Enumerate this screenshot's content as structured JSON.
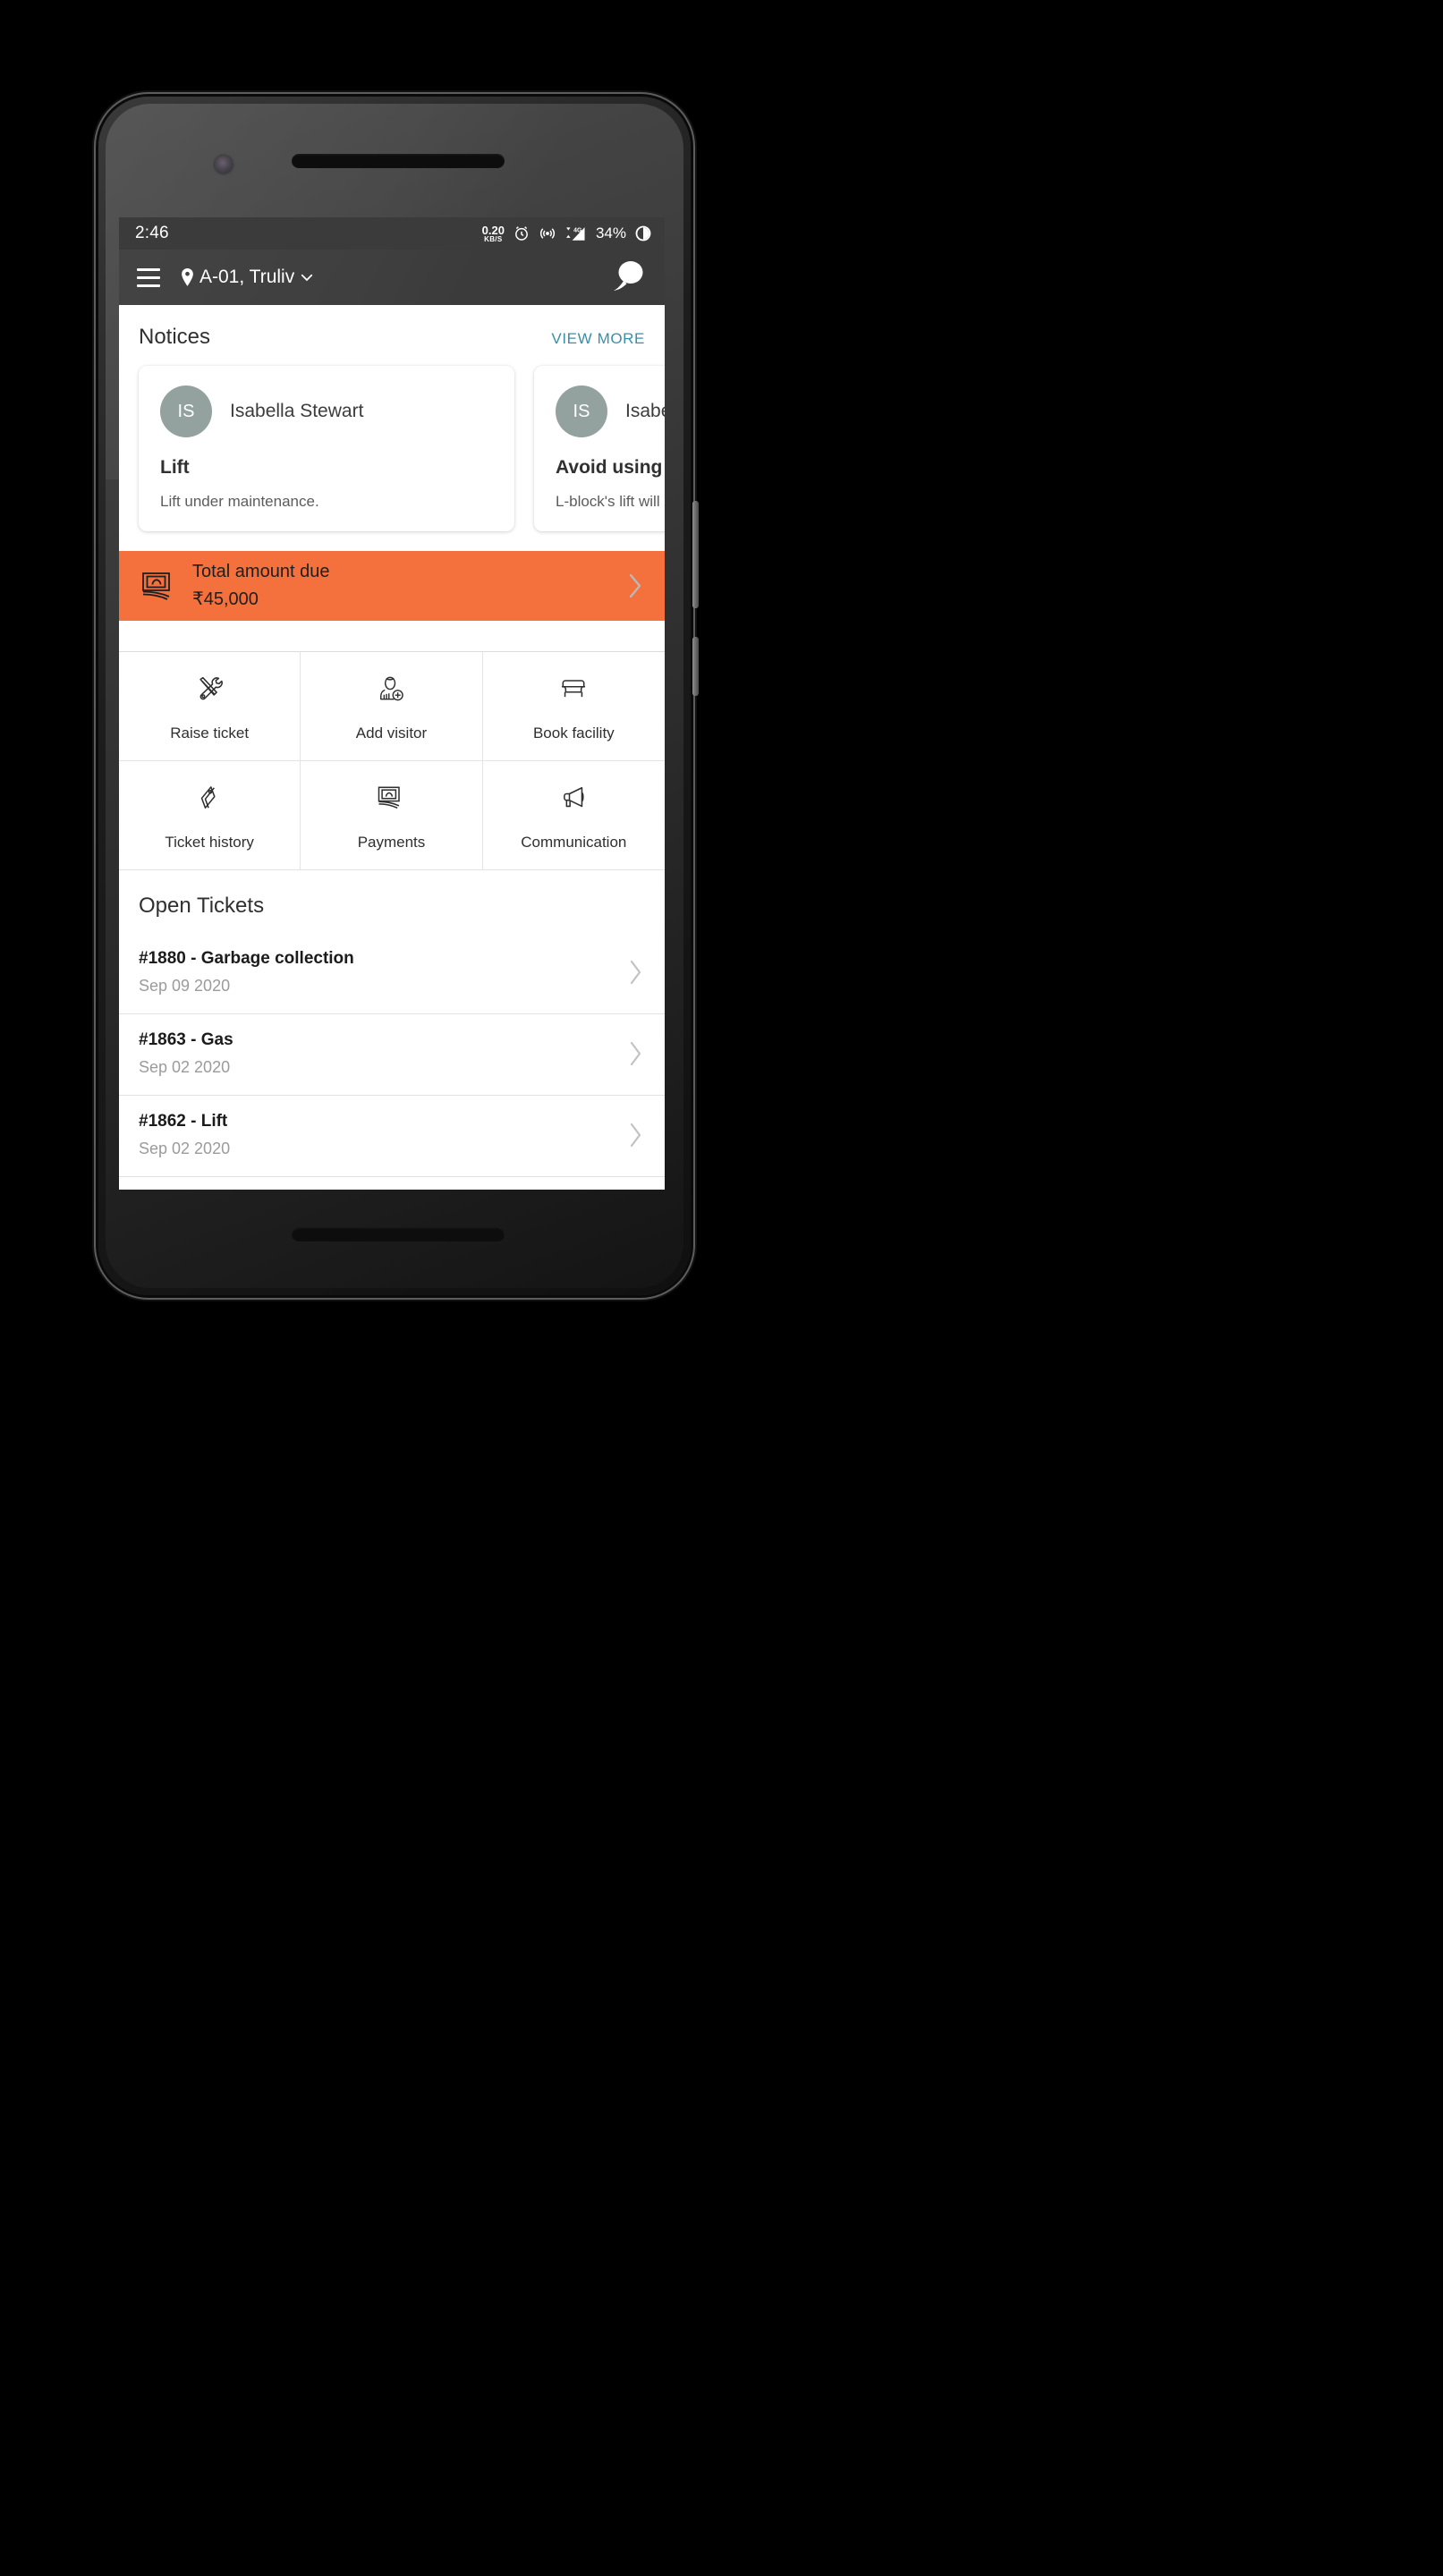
{
  "status_bar": {
    "time": "2:46",
    "net_speed_value": "0.20",
    "net_speed_unit": "KB/S",
    "network_type": "4G",
    "battery_percent": "34%",
    "icons": [
      "alarm-icon",
      "hotspot-icon",
      "signal-4g-icon",
      "battery-icon"
    ]
  },
  "app_bar": {
    "menu_icon": "hamburger-menu-icon",
    "location_icon": "location-pin-icon",
    "location_label": "A-01, Truliv",
    "dropdown_icon": "chevron-down-icon",
    "chat_icon": "chat-bubble-icon"
  },
  "notices": {
    "title": "Notices",
    "view_more_label": "VIEW MORE",
    "cards": [
      {
        "initials": "IS",
        "author": "Isabella Stewart",
        "subject": "Lift",
        "body": "Lift under maintenance."
      },
      {
        "initials": "IS",
        "author": "Isabella",
        "subject": "Avoid using L-Bl",
        "body": "L-block's lift will be"
      }
    ]
  },
  "amount_due": {
    "icon": "banknotes-icon",
    "label": "Total amount due",
    "value": "₹45,000",
    "chevron": "chevron-right-icon"
  },
  "actions": [
    {
      "label": "Raise ticket",
      "icon": "tools-icon"
    },
    {
      "label": "Add visitor",
      "icon": "person-add-icon"
    },
    {
      "label": "Book facility",
      "icon": "armchair-icon"
    },
    {
      "label": "Ticket history",
      "icon": "tags-icon"
    },
    {
      "label": "Payments",
      "icon": "banknotes-icon"
    },
    {
      "label": "Communication",
      "icon": "megaphone-icon"
    }
  ],
  "open_tickets": {
    "title": "Open Tickets",
    "rows": [
      {
        "title": "#1880 - Garbage collection",
        "date": "Sep 09 2020",
        "chevron": "chevron-right-icon"
      },
      {
        "title": "#1863 - Gas",
        "date": "Sep 02 2020",
        "chevron": "chevron-right-icon"
      },
      {
        "title": "#1862 - Lift",
        "date": "Sep 02 2020",
        "chevron": "chevron-right-icon"
      }
    ]
  },
  "colors": {
    "accent_orange": "#f4703c",
    "link_teal": "#3a8fa8",
    "appbar_dark": "#3b3b3b",
    "avatar_gray": "#93a29e"
  }
}
